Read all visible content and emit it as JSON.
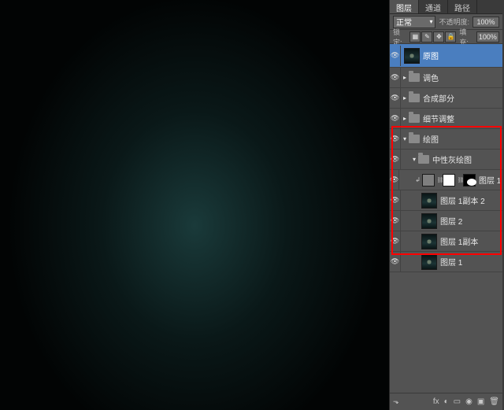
{
  "tabs": {
    "layers": "图层",
    "channels": "通道",
    "paths": "路径"
  },
  "blend": {
    "mode": "正常",
    "opacity_lbl": "不透明度:",
    "opacity_val": "100%"
  },
  "lock": {
    "label": "锁定:",
    "fill_lbl": "填充:",
    "fill_val": "100%"
  },
  "layers": {
    "top": {
      "name": "原图"
    },
    "g1": {
      "name": "调色"
    },
    "g2": {
      "name": "合成部分"
    },
    "g3": {
      "name": "细节调整"
    },
    "g4": {
      "name": "绘图"
    },
    "sub": {
      "g5": {
        "name": "中性灰绘图"
      },
      "l1": {
        "name": "图层 1..."
      },
      "l2": {
        "name": "图层 1副本 2"
      },
      "l3": {
        "name": "图层 2"
      },
      "l4": {
        "name": "图层 1副本"
      },
      "l5": {
        "name": "图层 1"
      }
    }
  },
  "footer_icons": [
    "fx",
    "◐",
    "▭",
    "◉",
    "▣",
    "🗑"
  ]
}
